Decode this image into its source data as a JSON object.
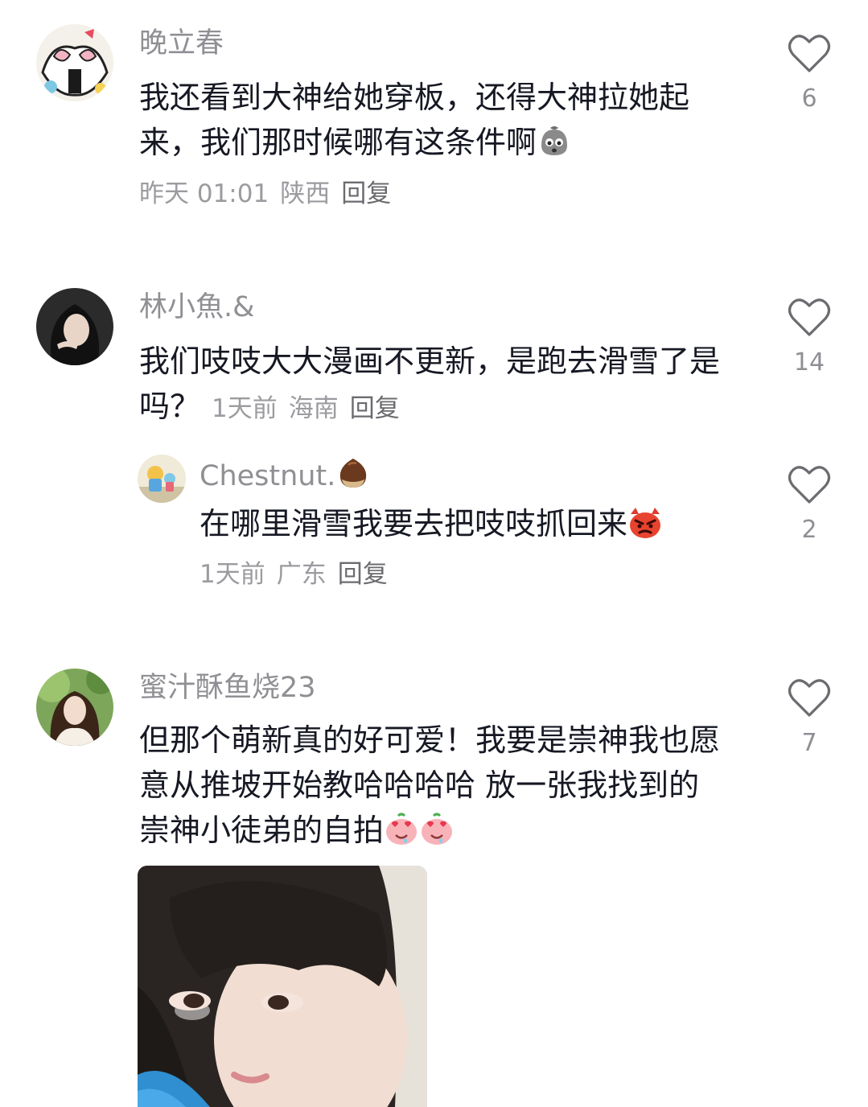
{
  "comments": [
    {
      "username": "晚立春",
      "text": "我还看到大神给她穿板，还得大神拉她起来，我们那时候哪有这条件啊",
      "text_emoji": "worried-face-emoji",
      "time": "昨天 01:01",
      "location": "陕西",
      "reply_label": "回复",
      "likes": "6"
    },
    {
      "username": "林小魚.&",
      "text": "我们吱吱大大漫画不更新，是跑去滑雪了是吗？",
      "time": "1天前",
      "location": "海南",
      "reply_label": "回复",
      "likes": "14",
      "reply": {
        "username": "Chestnut.",
        "username_emoji": "chestnut-emoji",
        "text": "在哪里滑雪我要去把吱吱抓回来",
        "text_emoji": "angry-face-emoji",
        "time": "1天前",
        "location": "广东",
        "reply_label": "回复",
        "likes": "2"
      }
    },
    {
      "username": "蜜汁酥鱼烧23",
      "text": "但那个萌新真的好可爱！我要是崇神我也愿意从推坡开始教哈哈哈哈 放一张我找到的崇神小徒弟的自拍",
      "text_emoji": "heart-eyes-emoji",
      "likes": "7",
      "attachment": "selfie-photo"
    }
  ],
  "colors": {
    "username": "#8f8f94",
    "body_text": "#161823",
    "meta": "#9b9ba0",
    "heart": "#6b6b70"
  }
}
